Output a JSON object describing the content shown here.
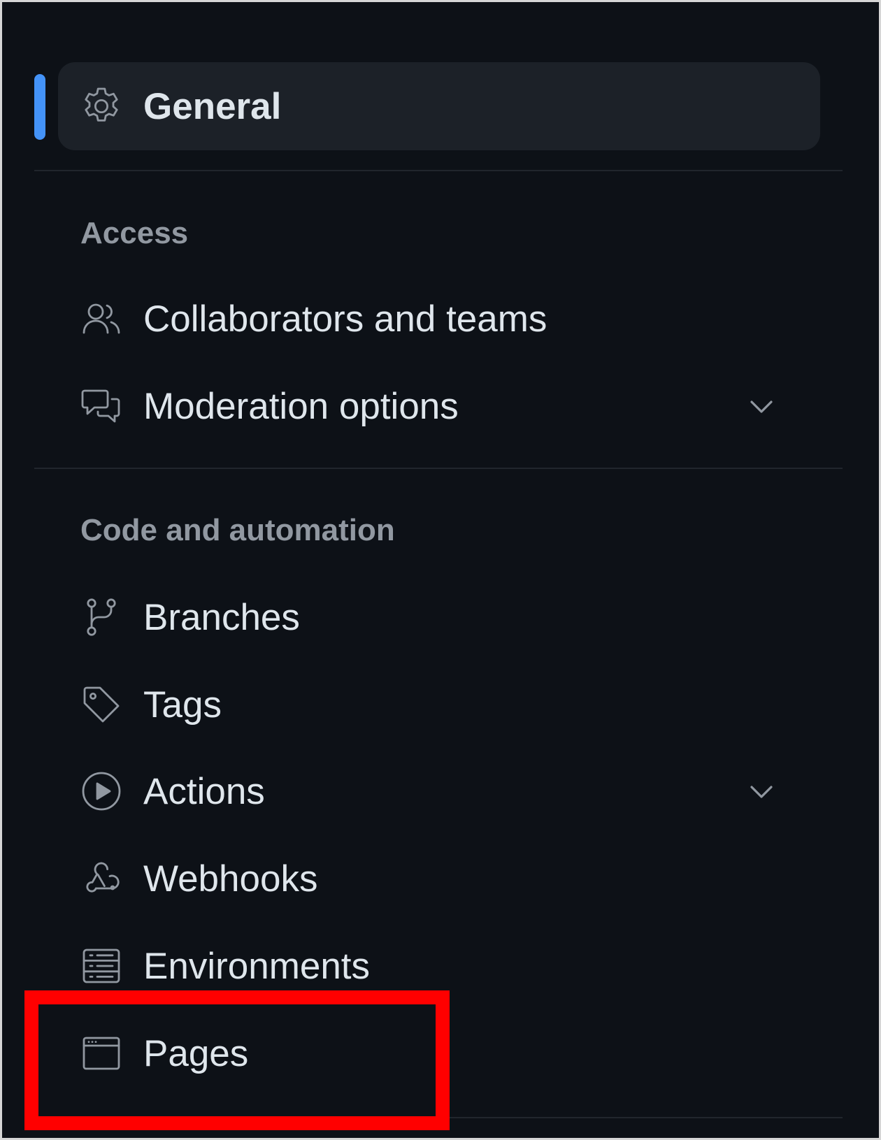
{
  "sidebar": {
    "general": {
      "label": "General",
      "icon": "gear-icon",
      "selected": true
    },
    "sections": [
      {
        "heading": "Access",
        "items": [
          {
            "label": "Collaborators and teams",
            "icon": "people-icon"
          },
          {
            "label": "Moderation options",
            "icon": "comment-discussion-icon",
            "expandable": true
          }
        ]
      },
      {
        "heading": "Code and automation",
        "items": [
          {
            "label": "Branches",
            "icon": "git-branch-icon"
          },
          {
            "label": "Tags",
            "icon": "tag-icon"
          },
          {
            "label": "Actions",
            "icon": "play-icon",
            "expandable": true
          },
          {
            "label": "Webhooks",
            "icon": "webhook-icon"
          },
          {
            "label": "Environments",
            "icon": "server-icon"
          },
          {
            "label": "Pages",
            "icon": "browser-icon",
            "highlighted": true
          }
        ]
      }
    ]
  },
  "colors": {
    "background": "#0d1117",
    "selected_background": "#1c2128",
    "active_indicator": "#4493f8",
    "highlight": "#ff0000",
    "icon": "#9198a1",
    "text": "#dfe6ec",
    "heading": "#9198a1"
  }
}
